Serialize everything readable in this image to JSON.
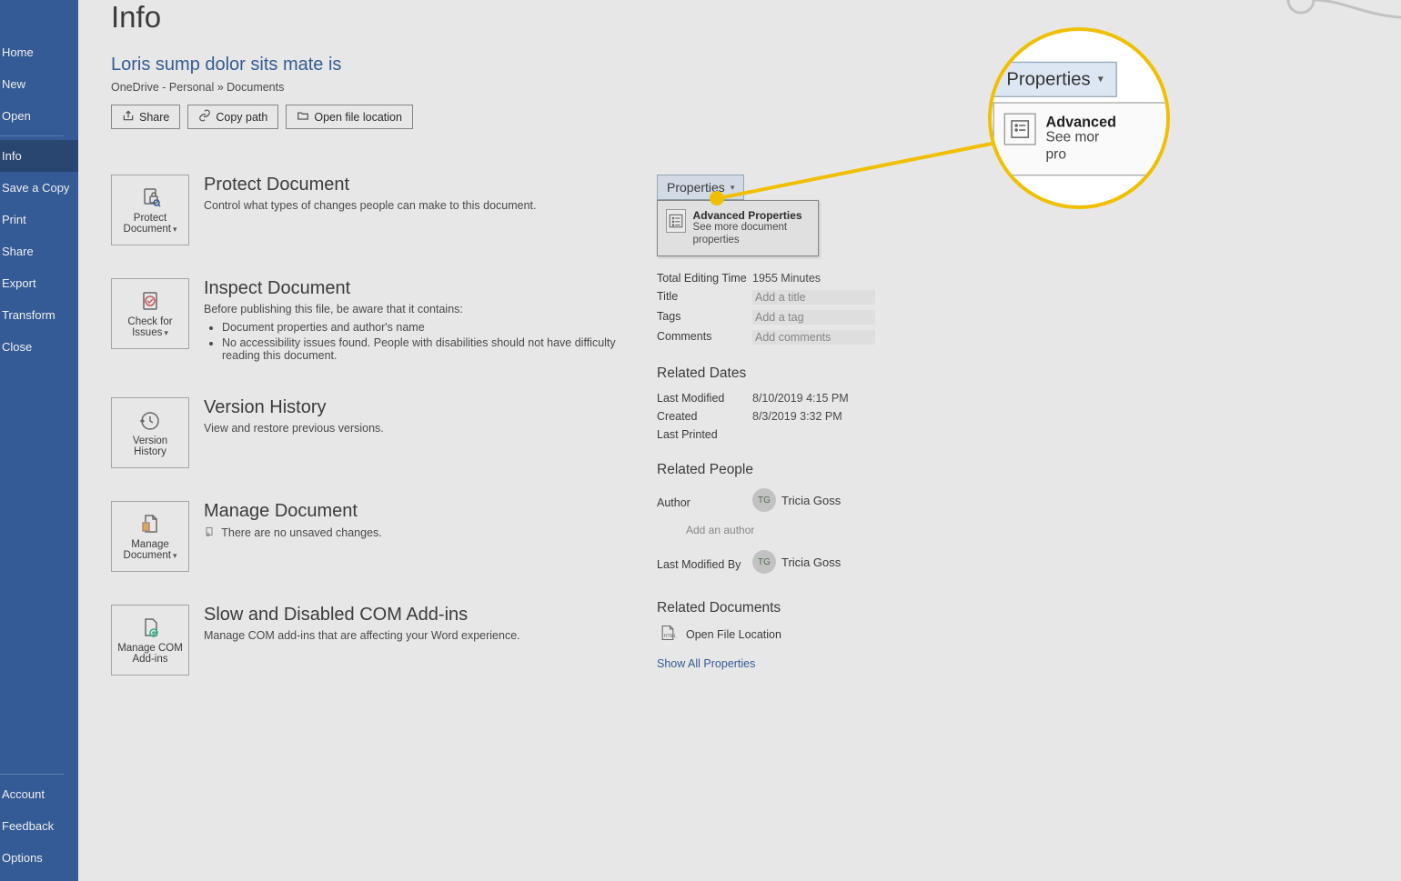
{
  "sidebar": {
    "top": [
      "Home",
      "New",
      "Open"
    ],
    "mid": [
      "Info",
      "Save a Copy",
      "Print",
      "Share",
      "Export",
      "Transform",
      "Close"
    ],
    "bottom": [
      "Account",
      "Feedback",
      "Options"
    ],
    "active": "Info"
  },
  "page": {
    "title": "Info",
    "doc_title": "Loris sump dolor sits mate is",
    "breadcrumb": "OneDrive - Personal » Documents"
  },
  "actions": {
    "share": "Share",
    "copy_path": "Copy path",
    "open_loc": "Open file location"
  },
  "sections": {
    "protect": {
      "title": "Protect Document",
      "desc": "Control what types of changes people can make to this document.",
      "btn": "Protect Document"
    },
    "inspect": {
      "title": "Inspect Document",
      "desc": "Before publishing this file, be aware that it contains:",
      "b1": "Document properties and author's name",
      "b2": "No accessibility issues found. People with disabilities should not have difficulty reading this document.",
      "btn": "Check for Issues"
    },
    "version": {
      "title": "Version History",
      "desc": "View and restore previous versions.",
      "btn": "Version History"
    },
    "manage": {
      "title": "Manage Document",
      "desc": "There are no unsaved changes.",
      "btn": "Manage Document"
    },
    "com": {
      "title": "Slow and Disabled COM Add-ins",
      "desc": "Manage COM add-ins that are affecting your Word experience.",
      "btn": "Manage COM Add-ins"
    }
  },
  "properties": {
    "button": "Properties",
    "advanced": {
      "title": "Advanced Properties",
      "desc": "See more document properties"
    },
    "rows": {
      "total_edit_label": "Total Editing Time",
      "total_edit_val": "1955 Minutes",
      "title_label": "Title",
      "title_ph": "Add a title",
      "tags_label": "Tags",
      "tags_ph": "Add a tag",
      "comments_label": "Comments",
      "comments_ph": "Add comments"
    },
    "dates": {
      "heading": "Related Dates",
      "modified_label": "Last Modified",
      "modified_val": "8/10/2019 4:15 PM",
      "created_label": "Created",
      "created_val": "8/3/2019 3:32 PM",
      "printed_label": "Last Printed",
      "printed_val": ""
    },
    "people": {
      "heading": "Related People",
      "author_label": "Author",
      "author_initials": "TG",
      "author_name": "Tricia Goss",
      "add_author": "Add an author",
      "lastmod_label": "Last Modified By",
      "lastmod_initials": "TG",
      "lastmod_name": "Tricia Goss"
    },
    "docs": {
      "heading": "Related Documents",
      "open_file": "Open File Location",
      "show_all": "Show All Properties"
    }
  },
  "magnifier": {
    "prop": "Properties",
    "adv_title": "Advanced",
    "adv_desc1": "See mor",
    "adv_desc2": "pro"
  }
}
